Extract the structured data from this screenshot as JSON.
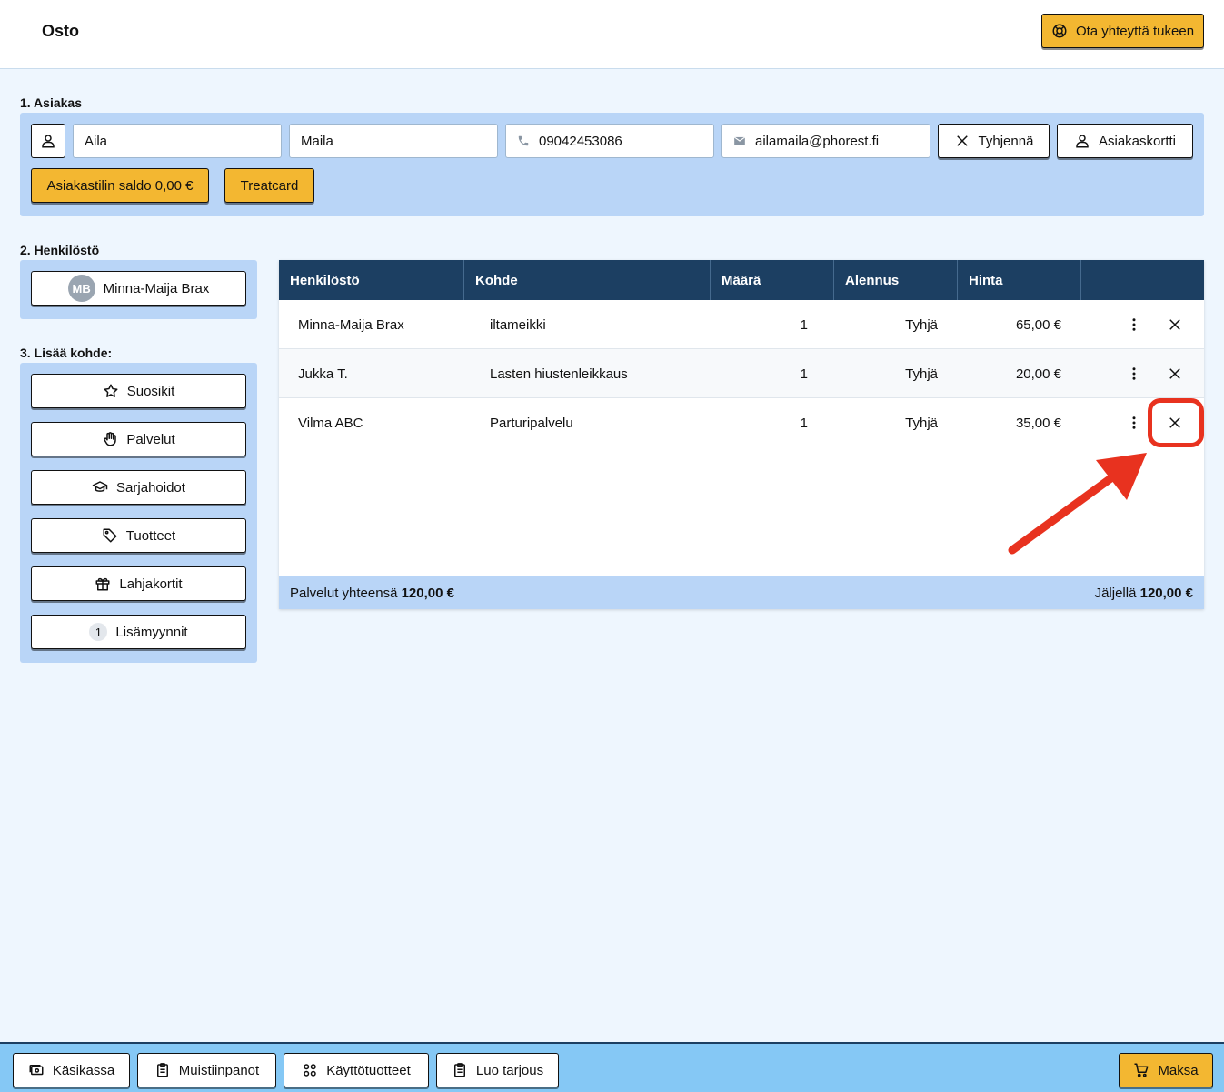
{
  "header": {
    "title": "Osto",
    "support_label": "Ota yhteyttä tukeen"
  },
  "customer": {
    "section_label": "1. Asiakas",
    "first_name": "Aila",
    "last_name": "Maila",
    "phone": "09042453086",
    "email": "ailamaila@phorest.fi",
    "clear_label": "Tyhjennä",
    "card_label": "Asiakaskortti",
    "balance_label": "Asiakastilin saldo 0,00 €",
    "treatcard_label": "Treatcard"
  },
  "staff": {
    "section_label": "2. Henkilöstö",
    "selected_initials": "MB",
    "selected_name": "Minna-Maija Brax"
  },
  "add_item": {
    "section_label": "3. Lisää kohde:",
    "buttons": [
      {
        "label": "Suosikit",
        "icon": "star-icon"
      },
      {
        "label": "Palvelut",
        "icon": "hand-icon"
      },
      {
        "label": "Sarjahoidot",
        "icon": "graduation-cap-icon"
      },
      {
        "label": "Tuotteet",
        "icon": "tag-icon"
      },
      {
        "label": "Lahjakortit",
        "icon": "gift-icon"
      },
      {
        "label": "Lisämyynnit",
        "icon": "count-badge",
        "badge": "1"
      }
    ]
  },
  "table": {
    "headers": [
      "Henkilöstö",
      "Kohde",
      "Määrä",
      "Alennus",
      "Hinta"
    ],
    "rows": [
      {
        "staff": "Minna-Maija Brax",
        "item": "iltameikki",
        "qty": "1",
        "discount": "Tyhjä",
        "price": "65,00 €"
      },
      {
        "staff": "Jukka T.",
        "item": "Lasten hiustenleikkaus",
        "qty": "1",
        "discount": "Tyhjä",
        "price": "20,00 €"
      },
      {
        "staff": "Vilma ABC",
        "item": "Parturipalvelu",
        "qty": "1",
        "discount": "Tyhjä",
        "price": "35,00 €"
      }
    ],
    "footer": {
      "total_label": "Palvelut yhteensä",
      "total_value": "120,00 €",
      "remaining_label": "Jäljellä",
      "remaining_value": "120,00 €"
    }
  },
  "bottom_bar": {
    "buttons": [
      {
        "label": "Käsikassa",
        "icon": "cash-icon"
      },
      {
        "label": "Muistiinpanot",
        "icon": "clipboard-icon"
      },
      {
        "label": "Käyttötuotteet",
        "icon": "grid-icon"
      },
      {
        "label": "Luo tarjous",
        "icon": "clipboard-icon"
      }
    ],
    "pay_label": "Maksa"
  },
  "colors": {
    "accent_yellow": "#f3b731",
    "header_navy": "#1c3f62",
    "panel_blue": "#b9d5f7",
    "bottom_bar_blue": "#85c8f5",
    "annotation_red": "#e8321f"
  }
}
